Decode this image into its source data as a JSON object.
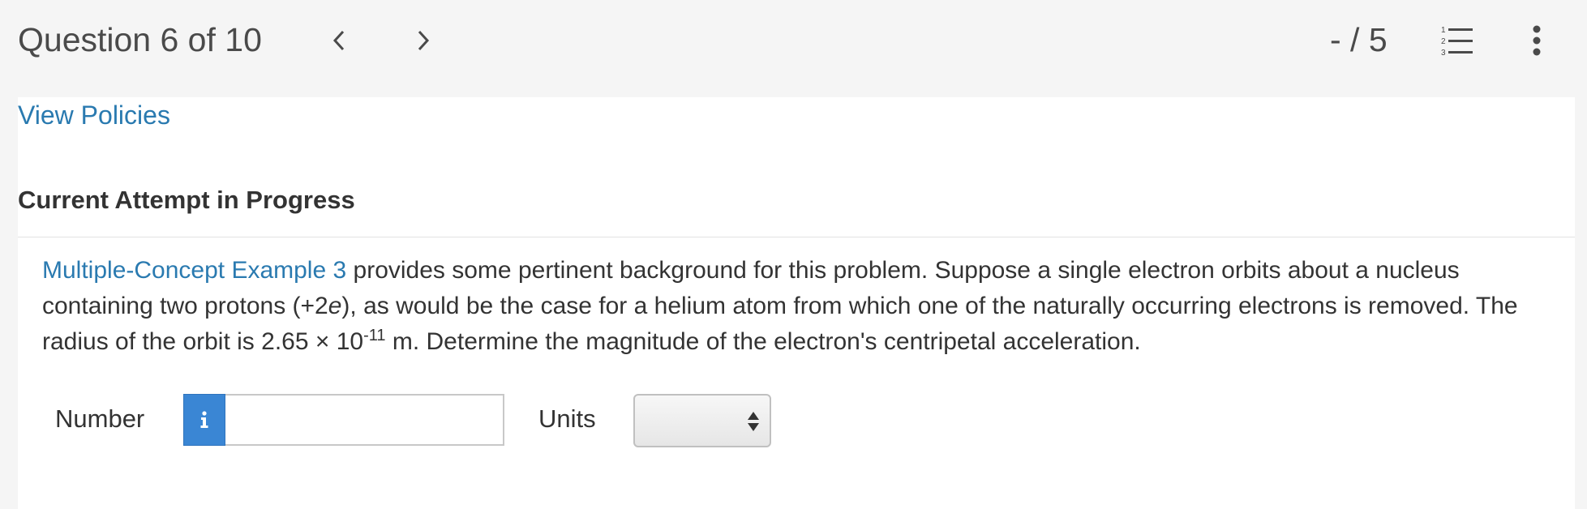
{
  "header": {
    "question_counter": "Question 6 of 10",
    "score": "- / 5",
    "prev_icon": "chevron-left-icon",
    "next_icon": "chevron-right-icon",
    "list_icon": "numbered-list-icon",
    "more_icon": "more-vertical-icon"
  },
  "content": {
    "policies_link": "View Policies",
    "attempt_heading": "Current Attempt in Progress",
    "question": {
      "link_text": "Multiple-Concept Example 3",
      "text_1": " provides some pertinent background for this problem. Suppose a single electron orbits about a nucleus containing two protons (+2",
      "text_italic": "e",
      "text_2": "), as would be the case for a helium atom from which one of the naturally occurring electrons is removed. The radius of the orbit is 2.65 × 10",
      "exponent": "-11",
      "text_3": " m. Determine the magnitude of the electron's centripetal acceleration."
    }
  },
  "answer": {
    "number_label": "Number",
    "info_icon": "info-icon",
    "number_value": "",
    "units_label": "Units",
    "units_selected": ""
  },
  "colors": {
    "link": "#2a7ab0",
    "info_button": "#3a86d4",
    "header_bg": "#f5f5f5"
  }
}
